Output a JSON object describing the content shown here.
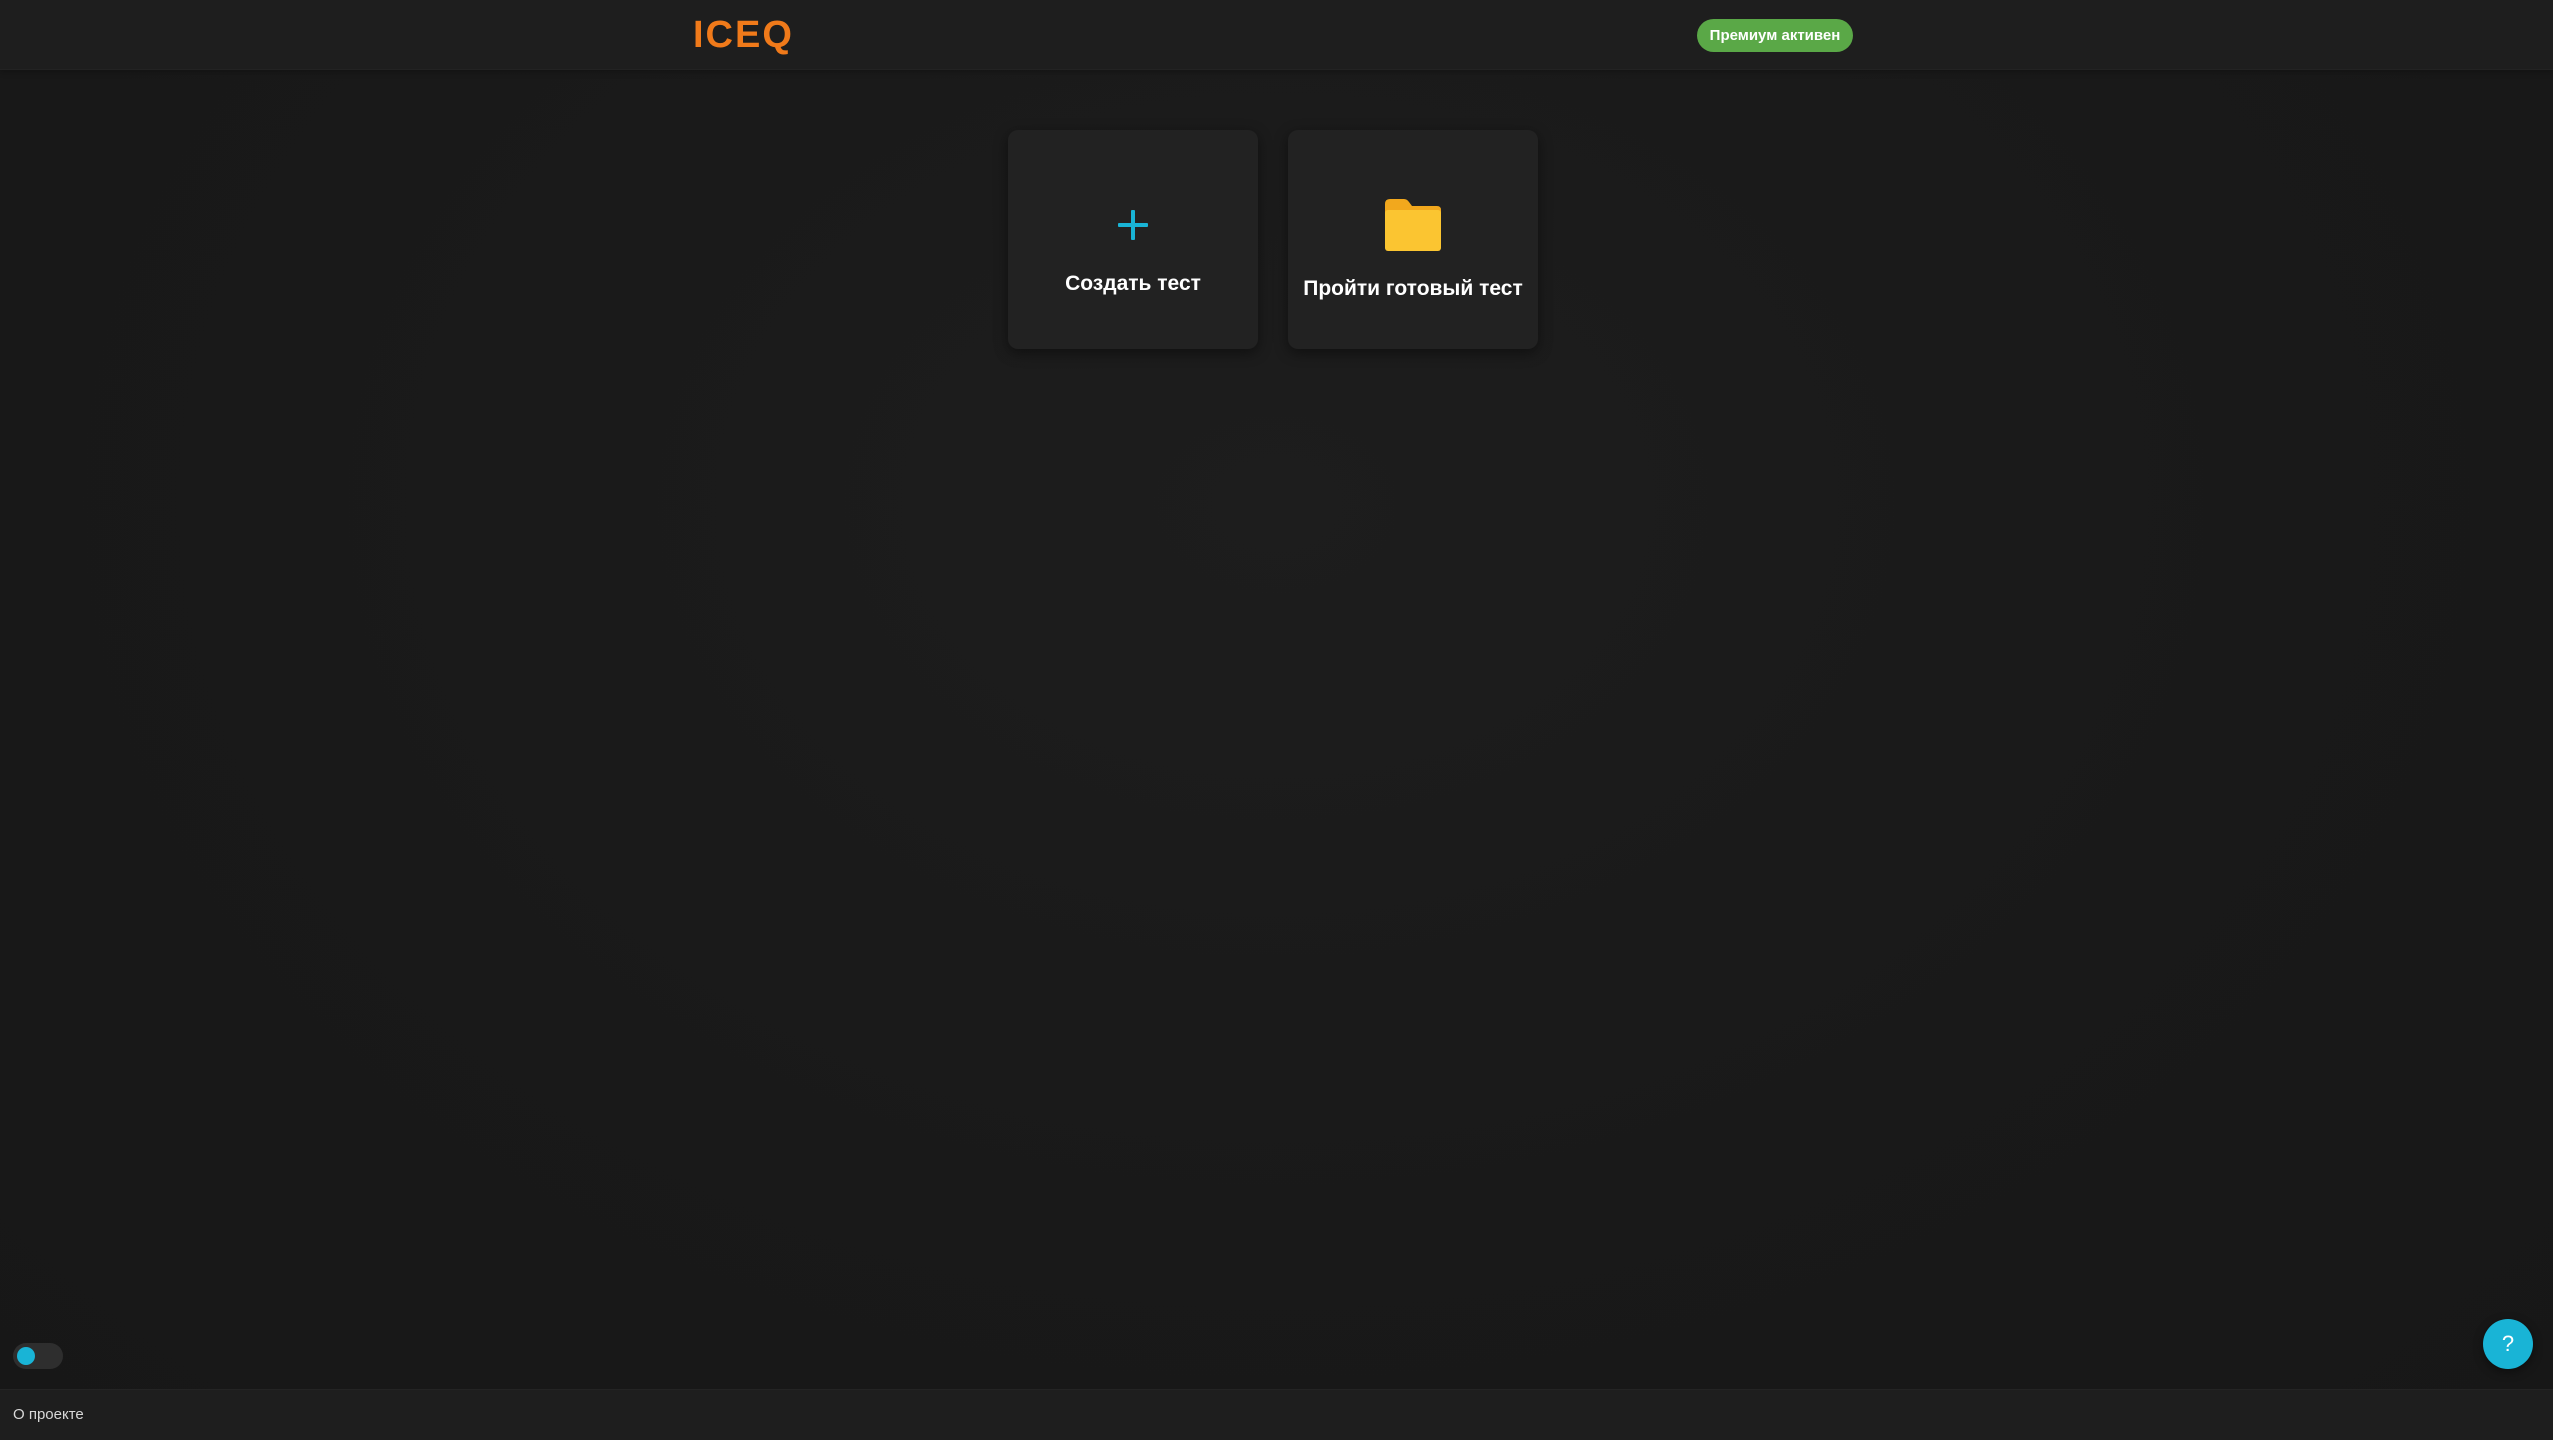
{
  "header": {
    "logo": "ICEQ",
    "premium_badge": "Премиум активен"
  },
  "cards": {
    "create": {
      "icon": "plus-icon",
      "label": "Создать тест"
    },
    "take": {
      "icon": "folder-icon",
      "label": "Пройти готовый тест"
    }
  },
  "theme_toggle": {
    "state": "dark"
  },
  "footer": {
    "about_link": "О проекте"
  },
  "help_button": {
    "icon": "?"
  },
  "colors": {
    "background": "#191919",
    "accent_orange": "#f07a1a",
    "accent_cyan": "#19b4d6",
    "premium_green": "#5aa847",
    "folder_yellow": "#fbc531"
  }
}
